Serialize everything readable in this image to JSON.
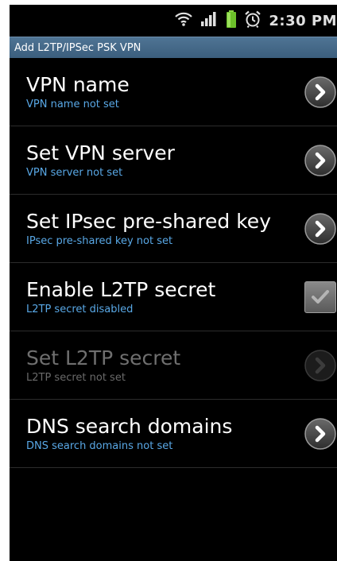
{
  "status_bar": {
    "time": "2:30 PM",
    "icons": [
      "wifi-icon",
      "signal-icon",
      "battery-icon",
      "alarm-icon"
    ]
  },
  "title_bar": {
    "title": "Add L2TP/IPSec PSK VPN"
  },
  "settings": [
    {
      "title": "VPN name",
      "subtitle": "VPN name not set",
      "control": "chevron",
      "enabled": true
    },
    {
      "title": "Set VPN server",
      "subtitle": "VPN server not set",
      "control": "chevron",
      "enabled": true
    },
    {
      "title": "Set IPsec pre-shared key",
      "subtitle": "IPsec pre-shared key not set",
      "control": "chevron",
      "enabled": true
    },
    {
      "title": "Enable L2TP secret",
      "subtitle": "L2TP secret disabled",
      "control": "checkbox",
      "checked": false,
      "enabled": true
    },
    {
      "title": "Set L2TP secret",
      "subtitle": "L2TP secret not set",
      "control": "chevron",
      "enabled": false
    },
    {
      "title": "DNS search domains",
      "subtitle": "DNS search domains not set",
      "control": "chevron",
      "enabled": true
    }
  ],
  "colors": {
    "background": "#000000",
    "title_bar": "#46698a",
    "subtitle": "#59a8e6",
    "disabled_text": "#6f6f6f"
  }
}
